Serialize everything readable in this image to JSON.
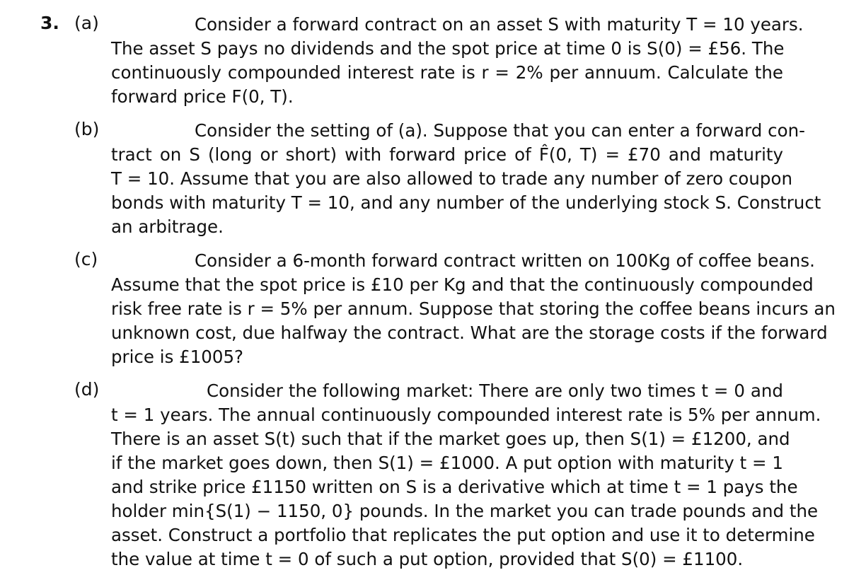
{
  "question_number": "3.",
  "parts": [
    {
      "label": "(a)",
      "lines": [
        "Consider a forward contract on an asset S with maturity T = 10 years.",
        "The asset S pays no dividends and the spot price at time 0 is S(0) = £56.  The",
        "continuously compounded interest rate is r = 2% per annuum.  Calculate the",
        "forward price F(0, T)."
      ]
    },
    {
      "label": "(b)",
      "lines": [
        "Consider the setting of (a). Suppose that you can enter a forward con-",
        "tract on S (long or short) with forward price of F̂(0, T) = £70 and maturity",
        "T = 10. Assume that you are also allowed to trade any number of zero coupon",
        "bonds with maturity T = 10, and any number of the underlying stock S. Construct",
        "an arbitrage."
      ]
    },
    {
      "label": "(c)",
      "lines": [
        "Consider a 6-month forward contract written on 100Kg of coffee beans.",
        "Assume that the spot price is £10 per Kg and that the continuously compounded",
        "risk free rate is r = 5% per annum. Suppose that storing the coffee beans incurs an",
        "unknown cost, due halfway the contract. What are the storage costs if the forward",
        "price is £1005?"
      ]
    },
    {
      "label": "(d)",
      "lines": [
        "Consider the following market: There are only two times t = 0 and",
        "t = 1 years. The annual continuously compounded interest rate is 5% per annum.",
        "There is an asset S(t) such that if the market goes up, then S(1) = £1200, and",
        "if the market goes down, then S(1) = £1000. A put option with maturity t = 1",
        "and strike price £1150 written on S is a derivative which at time t = 1 pays the",
        "holder min{S(1) − 1150, 0} pounds. In the market you can trade pounds and the",
        "asset. Construct a portfolio that replicates the put option and use it to determine",
        "the value at time t = 0 of such a put option, provided that S(0) = £1100."
      ]
    }
  ]
}
